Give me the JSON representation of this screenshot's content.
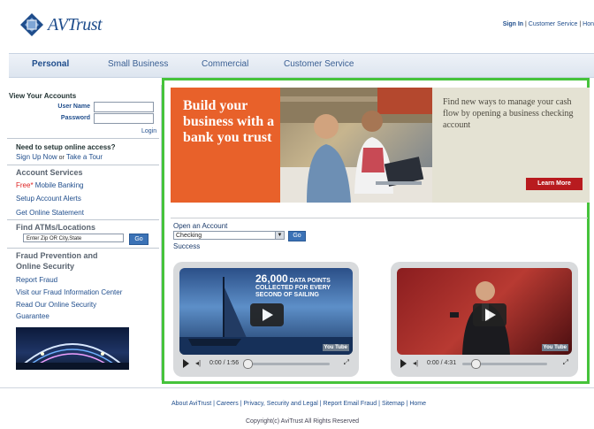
{
  "header": {
    "logo_text": "AVTrust",
    "utility_signin": "Sign In",
    "utility_separator": " | ",
    "utility_customer_service": "Customer Service",
    "utility_home": "Hon"
  },
  "nav": {
    "items": [
      "Personal",
      "Small Business",
      "Commercial",
      "Customer Service"
    ]
  },
  "sidebar": {
    "accounts_heading": "View Your Accounts",
    "username_label": "User Name",
    "password_label": "Password",
    "login_link": "Login",
    "setup_heading": "Need to setup online access?",
    "signup_link": "Sign Up Now",
    "or_text": " or ",
    "tour_link": "Take a Tour",
    "services_heading": "Account Services",
    "free_text": "Free*",
    "mobile_banking": " Mobile Banking",
    "setup_alerts": "Setup Account Alerts",
    "online_statement": "Get Online Statement",
    "atm_heading": "Find ATMs/Locations",
    "atm_placeholder": "Enter Zip OR City,State",
    "go_label": "Go",
    "fraud_heading_1": "Fraud Prevention and",
    "fraud_heading_2": "Online Security",
    "report_fraud": "Report Fraud",
    "fraud_center": "Visit our Fraud Information Center",
    "security_guarantee_1": "Read Our Online Security",
    "security_guarantee_2": "Guarantee"
  },
  "banner": {
    "left_text": "Build your business with a bank you trust",
    "right_text": "Find new ways to manage your cash flow by opening a business checking account",
    "learn_more": "Learn More"
  },
  "open_account": {
    "label": "Open an Account",
    "selected_option": "Checking",
    "go_label": "Go",
    "success": "Success"
  },
  "videos": [
    {
      "overlay_text_1": "26,000",
      "overlay_text_1b": " DATA POINTS",
      "overlay_text_2": "COLLECTED FOR EVERY",
      "overlay_text_3": "SECOND OF SAILING",
      "time": "0:00 / 1:56",
      "brand": "You Tube",
      "progress": 0.0
    },
    {
      "time": "0:00 / 4:31",
      "brand": "You Tube",
      "progress": 0.0
    }
  ],
  "footer": {
    "links": [
      "About AviTrust",
      "Careers",
      "Privacy, Security and Legal",
      "Report Email Fraud",
      "Sitemap",
      "Home"
    ],
    "copyright": "Copyright(c) AviTrust All Rights Reserved"
  },
  "colors": {
    "brand_blue": "#1f4d8c",
    "highlight_green": "#46c33b",
    "banner_orange": "#e8612a",
    "button_red": "#b81b1f"
  }
}
